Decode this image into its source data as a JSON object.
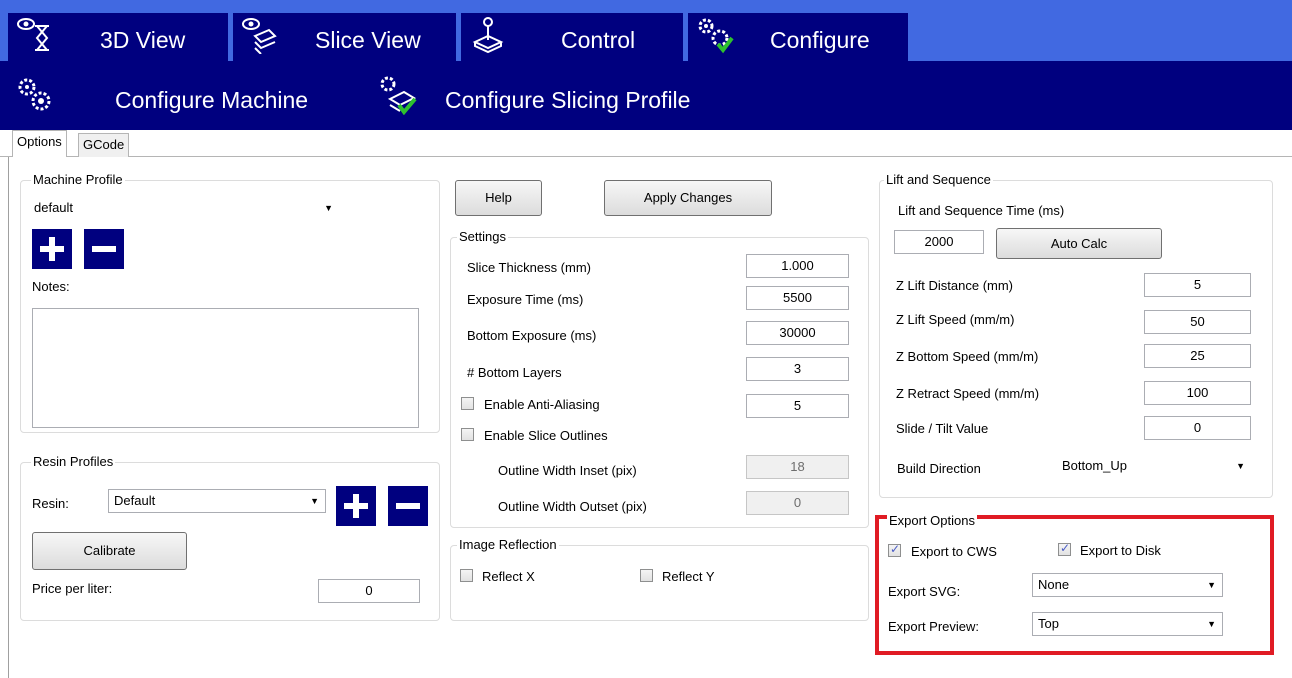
{
  "topbar": {
    "bg_color": "#4169e1",
    "button_color": "#00007f",
    "tabs": [
      {
        "label": "3D View",
        "icon": "eye-hourglass-icon"
      },
      {
        "label": "Slice View",
        "icon": "eye-layers-icon"
      },
      {
        "label": "Control",
        "icon": "joystick-icon"
      },
      {
        "label": "Configure",
        "icon": "gears-check-icon"
      }
    ]
  },
  "subbar": {
    "items": [
      {
        "label": "Configure Machine",
        "icon": "gears-icon"
      },
      {
        "label": "Configure Slicing Profile",
        "icon": "gear-layers-check-icon"
      }
    ]
  },
  "tabs": {
    "options": "Options",
    "gcode": "GCode"
  },
  "machine_profile": {
    "title": "Machine Profile",
    "selected": "default",
    "notes_label": "Notes:",
    "notes_value": ""
  },
  "resin_profiles": {
    "title": "Resin Profiles",
    "resin_label": "Resin:",
    "resin_selected": "Default",
    "calibrate_label": "Calibrate",
    "price_label": "Price per liter:",
    "price_value": "0"
  },
  "actions": {
    "help": "Help",
    "apply": "Apply Changes"
  },
  "settings": {
    "title": "Settings",
    "slice_thickness_label": "Slice Thickness (mm)",
    "slice_thickness_value": "1.000",
    "exposure_label": "Exposure Time (ms)",
    "exposure_value": "5500",
    "bottom_exposure_label": "Bottom Exposure (ms)",
    "bottom_exposure_value": "30000",
    "bottom_layers_label": "# Bottom Layers",
    "bottom_layers_value": "3",
    "anti_alias_label": "Enable Anti-Aliasing",
    "anti_alias_checked": false,
    "anti_alias_value": "5",
    "slice_outlines_label": "Enable Slice Outlines",
    "slice_outlines_checked": false,
    "outline_inset_label": "Outline Width Inset (pix)",
    "outline_inset_value": "18",
    "outline_outset_label": "Outline Width Outset (pix)",
    "outline_outset_value": "0"
  },
  "image_reflection": {
    "title": "Image Reflection",
    "reflect_x_label": "Reflect X",
    "reflect_x_checked": false,
    "reflect_y_label": "Reflect Y",
    "reflect_y_checked": false
  },
  "lift_sequence": {
    "title": "Lift and Sequence",
    "time_label": "Lift and Sequence Time (ms)",
    "time_value": "2000",
    "auto_calc_label": "Auto Calc",
    "z_lift_distance_label": "Z Lift Distance (mm)",
    "z_lift_distance_value": "5",
    "z_lift_speed_label": "Z Lift Speed (mm/m)",
    "z_lift_speed_value": "50",
    "z_bottom_speed_label": "Z Bottom Speed (mm/m)",
    "z_bottom_speed_value": "25",
    "z_retract_speed_label": "Z Retract Speed (mm/m)",
    "z_retract_speed_value": "100",
    "slide_tilt_label": "Slide / Tilt Value",
    "slide_tilt_value": "0",
    "build_direction_label": "Build Direction",
    "build_direction_value": "Bottom_Up"
  },
  "export_options": {
    "title": "Export Options",
    "cws_label": "Export to CWS",
    "cws_checked": true,
    "disk_label": "Export to Disk",
    "disk_checked": true,
    "svg_label": "Export SVG:",
    "svg_value": "None",
    "preview_label": "Export Preview:",
    "preview_value": "Top",
    "highlight_color": "#e01b24"
  }
}
